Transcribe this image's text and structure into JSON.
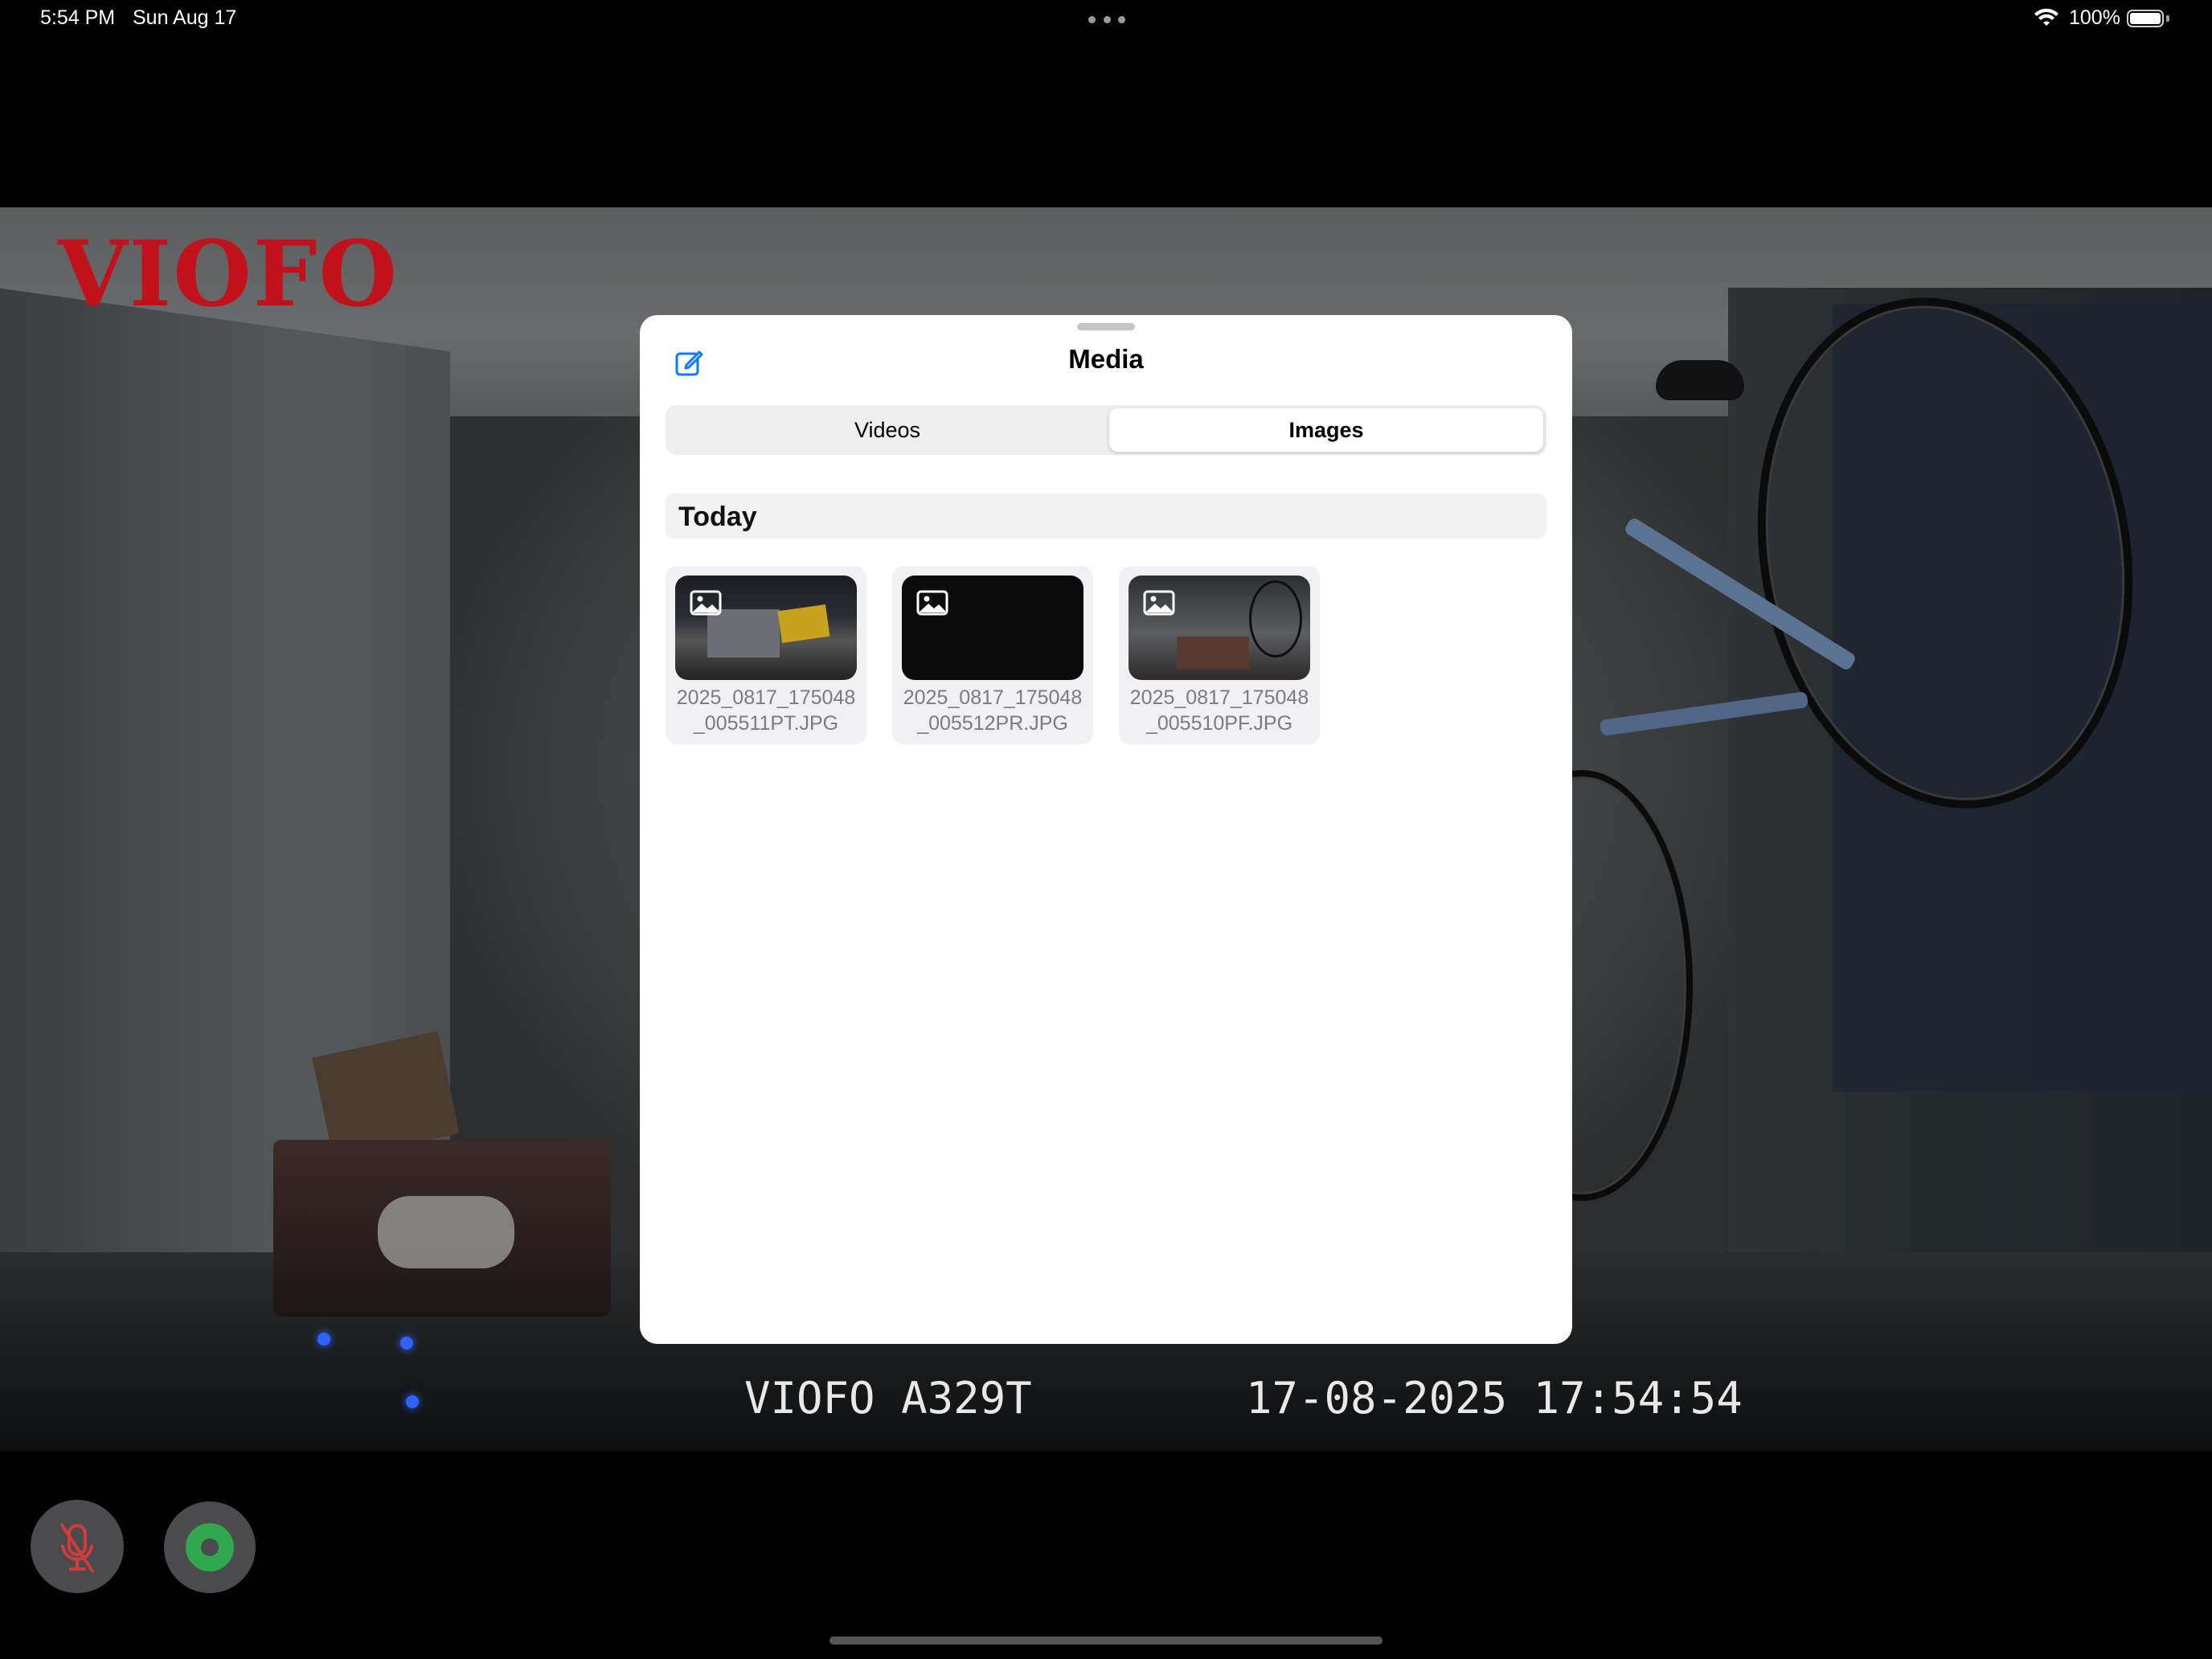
{
  "status_bar": {
    "time": "5:54 PM",
    "date": "Sun Aug 17",
    "battery": "100%"
  },
  "camera": {
    "brand_logo": "VIOFO",
    "model_overlay": "VIOFO A329T",
    "timestamp_overlay": "17-08-2025 17:54:54"
  },
  "media_sheet": {
    "title": "Media",
    "tabs": [
      {
        "label": "Videos",
        "selected": false
      },
      {
        "label": "Images",
        "selected": true
      }
    ],
    "section": "Today",
    "items": [
      {
        "name": "2025_0817_175048\n_005511PT.JPG",
        "icon": "image-icon"
      },
      {
        "name": "2025_0817_175048\n_005512PR.JPG",
        "icon": "image-icon"
      },
      {
        "name": "2025_0817_175048\n_005510PF.JPG",
        "icon": "image-icon"
      }
    ]
  },
  "controls": {
    "mic_icon": "mic-muted-icon",
    "record_icon": "record-icon",
    "mic_color": "#d23b3b",
    "record_color": "#2fa84f"
  },
  "colors": {
    "accent": "#0a7aff",
    "logo_red": "#c1121c"
  }
}
